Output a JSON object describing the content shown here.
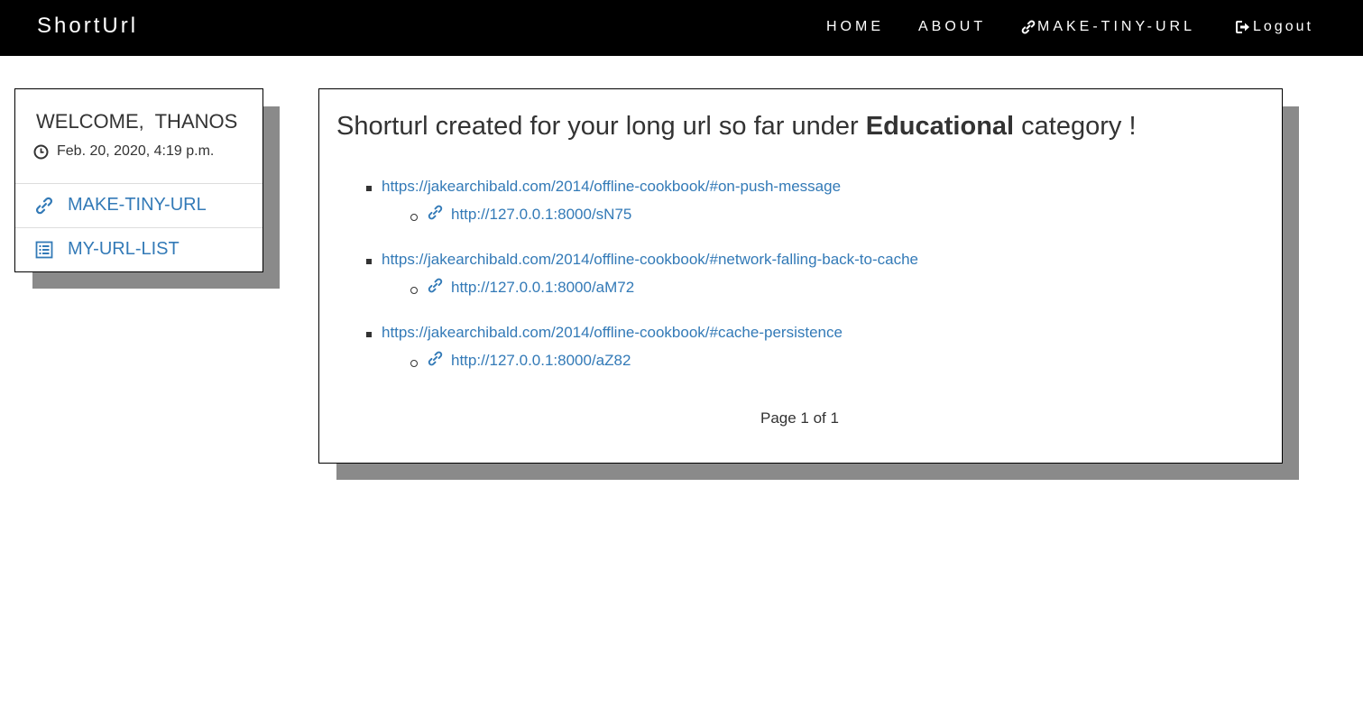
{
  "navbar": {
    "brand": "ShortUrl",
    "links": [
      "HOME",
      "ABOUT",
      "MAKE-TINY-URL",
      "Logout"
    ]
  },
  "sidebar": {
    "welcome": "WELCOME,  THANOS",
    "datetime": "Feb. 20, 2020, 4:19 p.m.",
    "items": [
      {
        "label": "MAKE-TINY-URL",
        "icon": "link-icon"
      },
      {
        "label": "MY-URL-LIST",
        "icon": "list-icon"
      }
    ]
  },
  "main": {
    "heading_prefix": "Shorturl created for your long url so far under ",
    "category": "Educational",
    "heading_suffix": " category !",
    "entries": [
      {
        "long_url": "https://jakearchibald.com/2014/offline-cookbook/#on-push-message",
        "short_url": "http://127.0.0.1:8000/sN75"
      },
      {
        "long_url": "https://jakearchibald.com/2014/offline-cookbook/#network-falling-back-to-cache",
        "short_url": "http://127.0.0.1:8000/aM72"
      },
      {
        "long_url": "https://jakearchibald.com/2014/offline-cookbook/#cache-persistence",
        "short_url": "http://127.0.0.1:8000/aZ82"
      }
    ],
    "pagination": "Page 1 of 1"
  },
  "colors": {
    "navbar_bg": "#000000",
    "link": "#337ab7",
    "shadow": "#8a8a8a"
  }
}
